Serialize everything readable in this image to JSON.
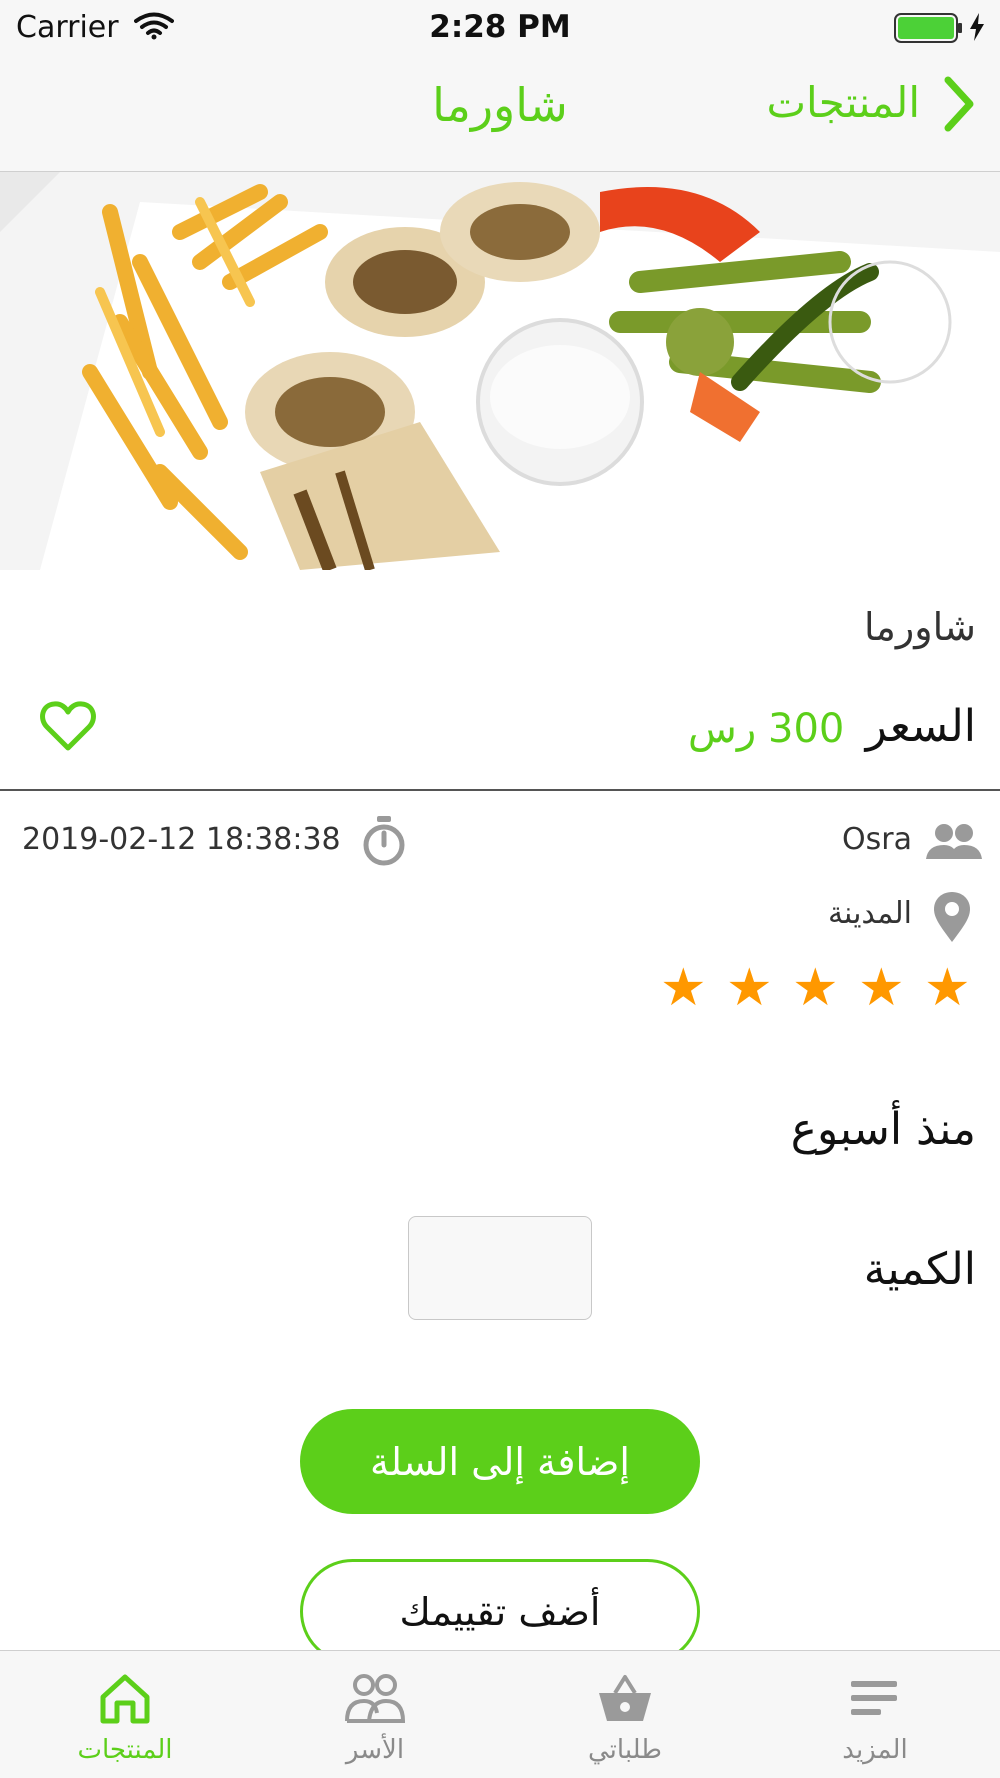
{
  "status_bar": {
    "carrier": "Carrier",
    "time": "2:28 PM"
  },
  "nav": {
    "back_label": "المنتجات",
    "title": "شاورما"
  },
  "product": {
    "name": "شاورما",
    "price_label": "السعر",
    "price_value": "300",
    "currency": "رس",
    "images_count_dots": 2
  },
  "meta": {
    "shop_name": "Osra",
    "city": "المدينة",
    "datetime": "2019-02-12 18:38:38",
    "rating": 5,
    "rating_max": 5,
    "time_ago": "منذ أسبوع"
  },
  "quantity": {
    "label": "الكمية",
    "value": ""
  },
  "actions": {
    "add_to_cart": "إضافة إلى السلة",
    "add_review": "أضف تقييمك"
  },
  "tabs": [
    {
      "label": "المنتجات",
      "icon": "home-icon",
      "active": true
    },
    {
      "label": "الأسر",
      "icon": "users-icon",
      "active": false
    },
    {
      "label": "طلباتي",
      "icon": "basket-icon",
      "active": false
    },
    {
      "label": "المزيد",
      "icon": "menu-icon",
      "active": false
    }
  ],
  "colors": {
    "accent": "#5ccf1a",
    "star": "#ff9800",
    "inactive": "#8a8a8a"
  }
}
